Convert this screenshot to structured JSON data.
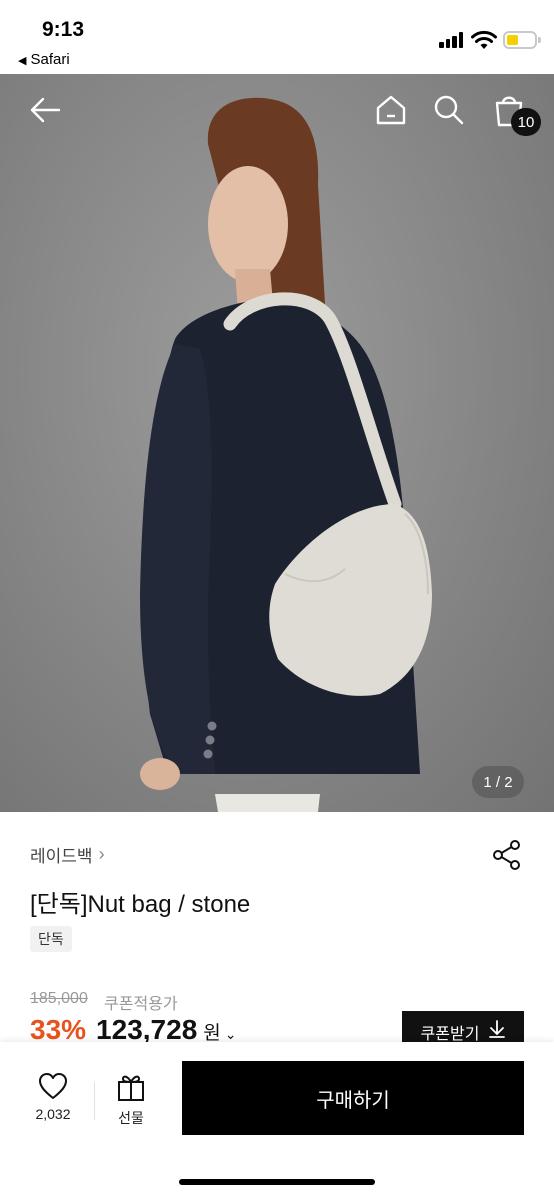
{
  "status_bar": {
    "time": "9:13",
    "back_app": "Safari",
    "battery_color": "#f5d000"
  },
  "header": {
    "back_icon": "arrow-left-icon",
    "home_icon": "home-icon",
    "search_icon": "search-icon",
    "cart_icon": "shopping-bag-icon",
    "cart_count": "10"
  },
  "gallery": {
    "page_indicator": "1 / 2"
  },
  "product": {
    "brand": "레이드백",
    "brand_chevron": "›",
    "title": "[단독]Nut bag / stone",
    "tag": "단독",
    "original_price": "185,000",
    "coupon_note": "쿠폰적용가",
    "discount": "33%",
    "price": "123,728",
    "currency": "원",
    "price_chevron": "⌄",
    "discount_color": "#e8521e"
  },
  "coupon_button": {
    "label": "쿠폰받기",
    "icon": "download-arrow-icon"
  },
  "bottom_bar": {
    "like_icon": "heart-icon",
    "like_count": "2,032",
    "gift_icon": "gift-icon",
    "gift_label": "선물",
    "buy_label": "구매하기"
  }
}
